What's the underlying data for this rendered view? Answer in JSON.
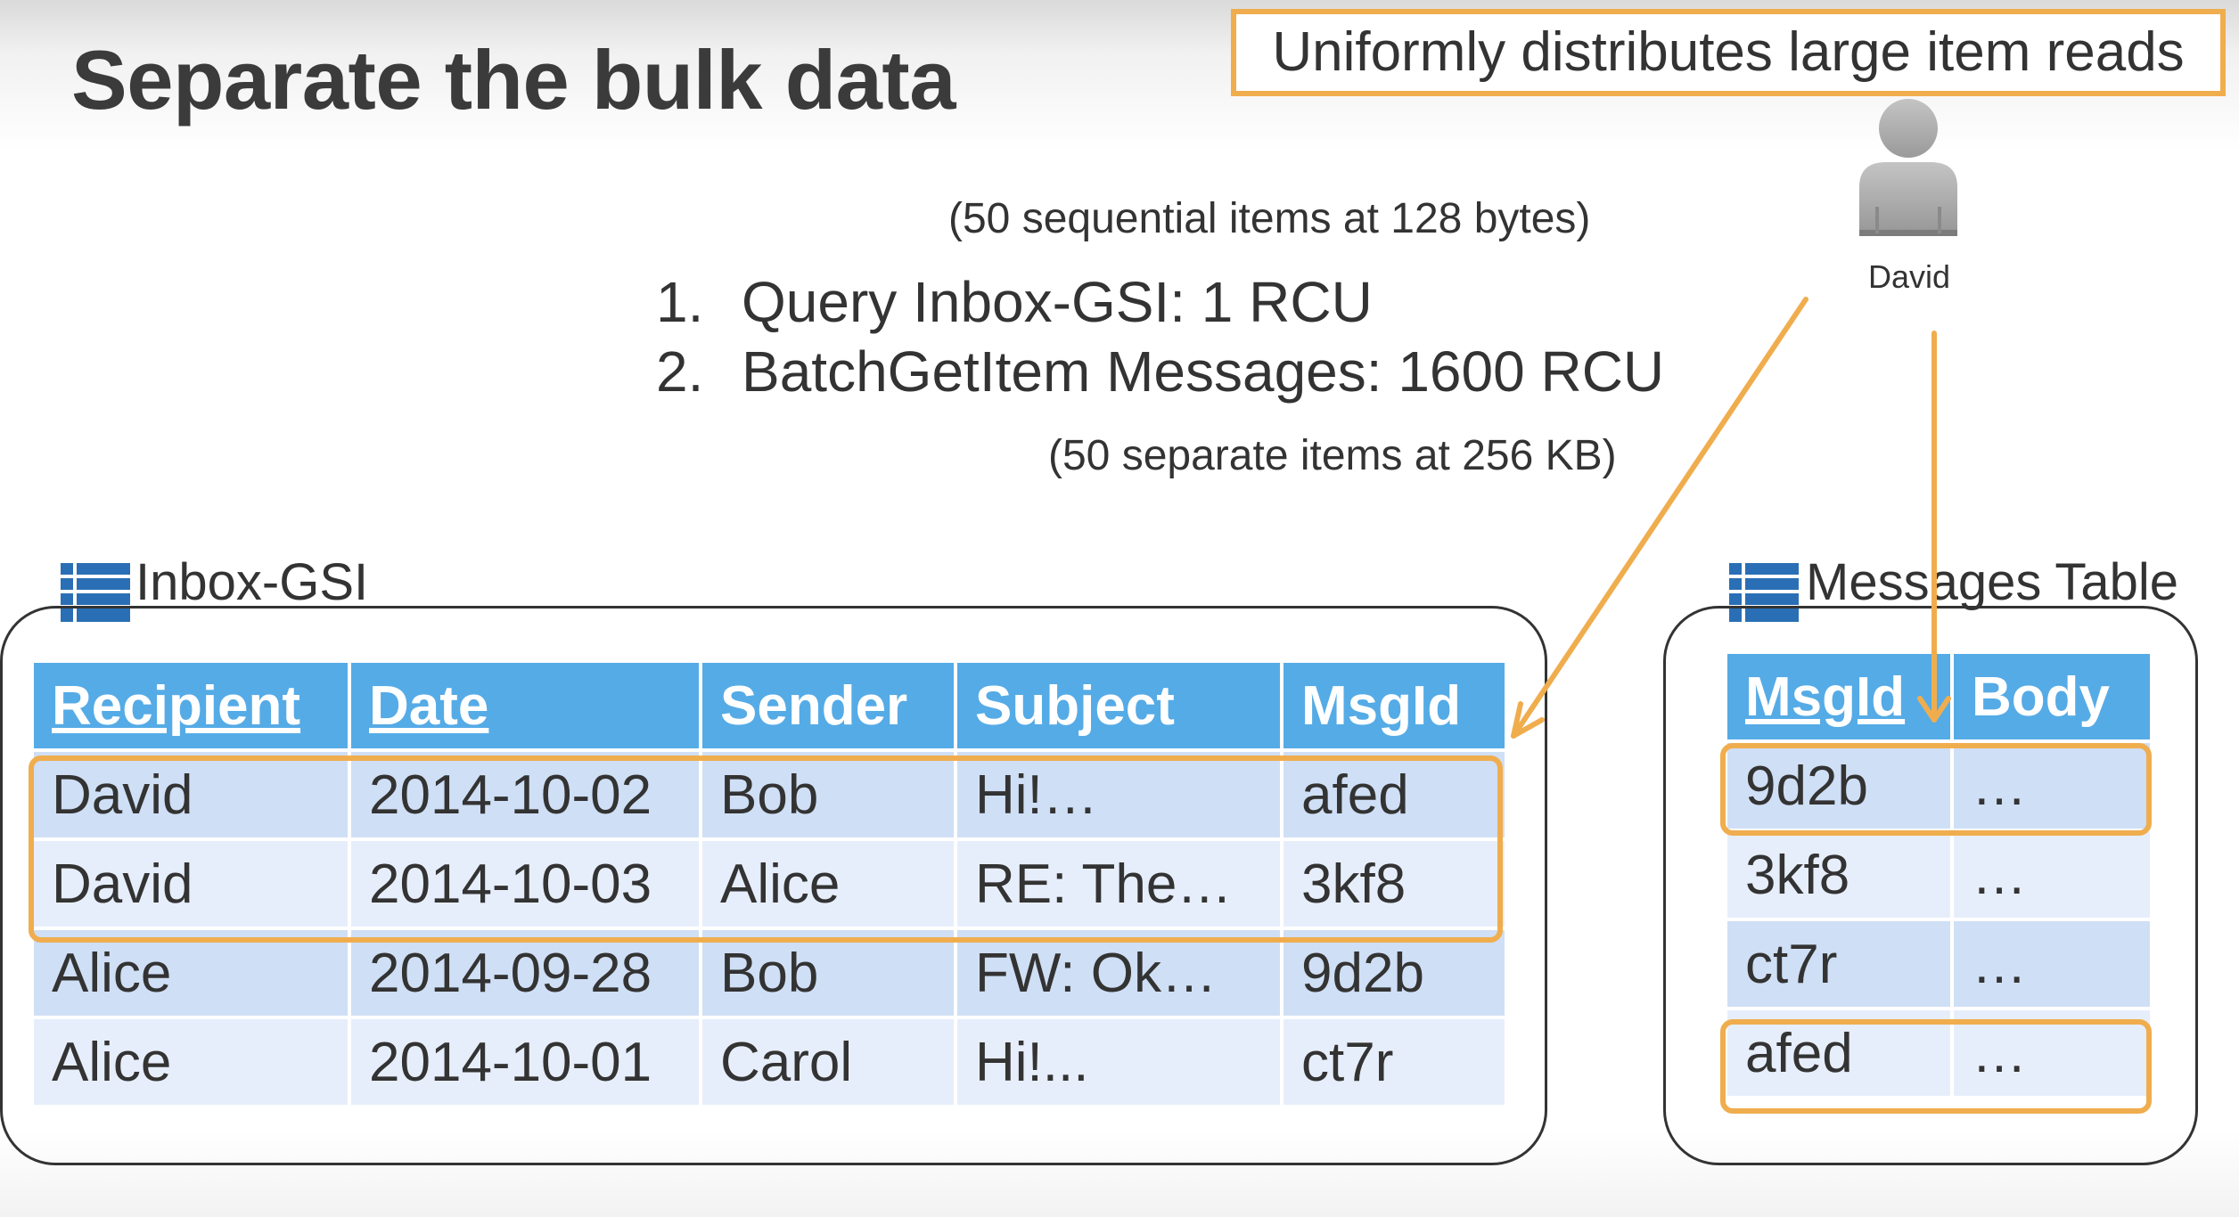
{
  "slide": {
    "title": "Separate the bulk data",
    "callout": "Uniformly distributes large item reads",
    "note_top": "(50 sequential items at 128 bytes)",
    "steps": [
      {
        "number": "1.",
        "text": "Query Inbox-GSI: 1 RCU"
      },
      {
        "number": "2.",
        "text": "BatchGetItem Messages: 1600 RCU"
      }
    ],
    "note_bottom": "(50 separate items at 256 KB)",
    "user": {
      "icon": "user-icon",
      "label": "David"
    }
  },
  "inbox": {
    "label": "Inbox-GSI",
    "icon": "table-icon",
    "columns": [
      "Recipient",
      "Date",
      "Sender",
      "Subject",
      "MsgId"
    ],
    "rows": [
      [
        "David",
        "2014-10-02",
        "Bob",
        "Hi!…",
        "afed"
      ],
      [
        "David",
        "2014-10-03",
        "Alice",
        "RE: The…",
        "3kf8"
      ],
      [
        "Alice",
        "2014-09-28",
        "Bob",
        "FW: Ok…",
        "9d2b"
      ],
      [
        "Alice",
        "2014-10-01",
        "Carol",
        "Hi!...",
        "ct7r"
      ]
    ]
  },
  "messages": {
    "label": "Messages Table",
    "icon": "table-icon",
    "columns": [
      "MsgId",
      "Body"
    ],
    "rows": [
      [
        "9d2b",
        "…"
      ],
      [
        "3kf8",
        "…"
      ],
      [
        "ct7r",
        "…"
      ],
      [
        "afed",
        "…"
      ]
    ]
  },
  "colors": {
    "header": "#55abe6",
    "row_dark": "#cfdff5",
    "row_light": "#e7eefb",
    "highlight": "#f0ad4e",
    "icon": "#2a6fb5"
  }
}
